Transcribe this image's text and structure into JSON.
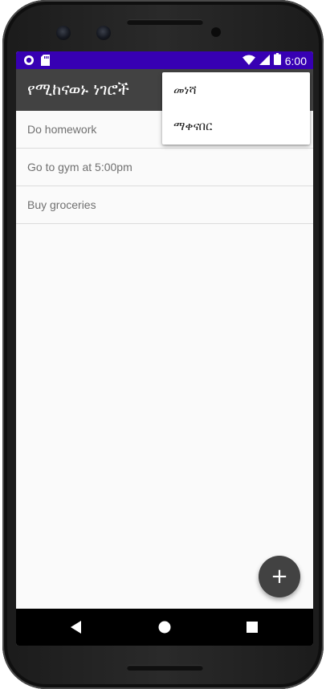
{
  "status_bar": {
    "time": "6:00",
    "background_color": "#3700b3",
    "left_icons": [
      "notification-circle-icon",
      "sd-card-icon"
    ],
    "right_icons": [
      "wifi-icon",
      "cellular-signal-icon",
      "battery-icon"
    ]
  },
  "app_bar": {
    "title": "የሚከናወኑ ነገሮች",
    "background_color": "#424242"
  },
  "overflow_menu": {
    "items": [
      {
        "label": "መነሻ"
      },
      {
        "label": "ማቀናበር"
      }
    ]
  },
  "todos": [
    {
      "text": "Do homework"
    },
    {
      "text": "Go to gym at 5:00pm"
    },
    {
      "text": "Buy groceries"
    }
  ],
  "fab": {
    "icon": "plus-icon",
    "glyph": "+",
    "color": "#424242"
  },
  "nav_bar": {
    "buttons": [
      "back-icon",
      "home-icon",
      "recents-icon"
    ]
  }
}
